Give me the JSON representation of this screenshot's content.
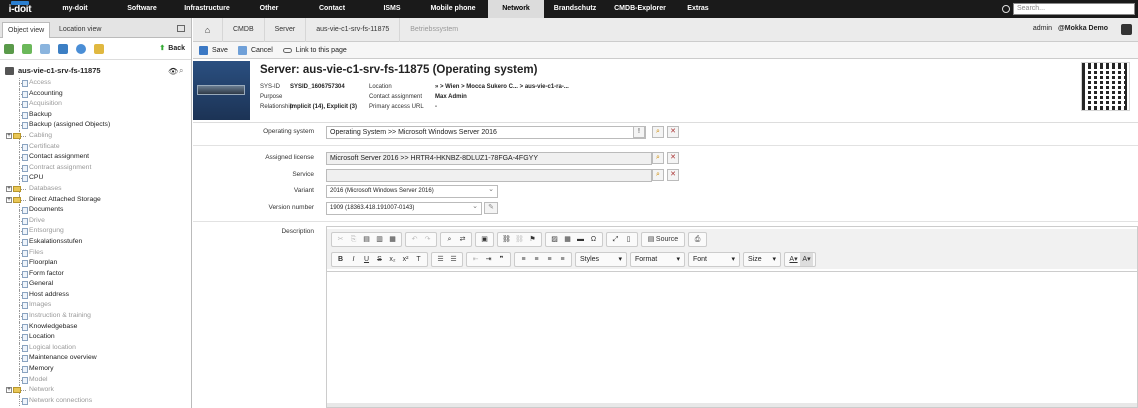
{
  "topbar": {
    "logo": "i-doit",
    "menu": [
      {
        "label": "my-doit",
        "active": false
      },
      {
        "label": "Software",
        "active": false
      },
      {
        "label": "Infrastructure",
        "active": false
      },
      {
        "label": "Other",
        "active": false
      },
      {
        "label": "Contact",
        "active": false
      },
      {
        "label": "ISMS",
        "active": false
      },
      {
        "label": "Mobile phone",
        "active": false
      },
      {
        "label": "Network",
        "active": true
      },
      {
        "label": "Brandschutz",
        "active": false
      },
      {
        "label": "CMDB-Explorer",
        "active": false
      },
      {
        "label": "Extras",
        "active": false
      }
    ],
    "search_placeholder": "Search..."
  },
  "left": {
    "tabs": [
      "Object view",
      "Location view"
    ],
    "back_label": "Back",
    "object_name": "aus-vie-c1-srv-fs-11875",
    "tree": [
      {
        "label": "Access",
        "grey": true,
        "folder": false
      },
      {
        "label": "Accounting",
        "grey": false,
        "folder": false
      },
      {
        "label": "Acquisition",
        "grey": true,
        "folder": false
      },
      {
        "label": "Backup",
        "grey": false,
        "folder": false
      },
      {
        "label": "Backup (assigned Objects)",
        "grey": false,
        "folder": false
      },
      {
        "label": "Cabling",
        "grey": true,
        "folder": true
      },
      {
        "label": "Certificate",
        "grey": true,
        "folder": false
      },
      {
        "label": "Contact assignment",
        "grey": false,
        "folder": false
      },
      {
        "label": "Contract assignment",
        "grey": true,
        "folder": false
      },
      {
        "label": "CPU",
        "grey": false,
        "folder": false
      },
      {
        "label": "Databases",
        "grey": true,
        "folder": true
      },
      {
        "label": "Direct Attached Storage",
        "grey": false,
        "folder": true
      },
      {
        "label": "Documents",
        "grey": false,
        "folder": false
      },
      {
        "label": "Drive",
        "grey": true,
        "folder": false
      },
      {
        "label": "Entsorgung",
        "grey": true,
        "folder": false
      },
      {
        "label": "Eskalationsstufen",
        "grey": false,
        "folder": false
      },
      {
        "label": "Files",
        "grey": true,
        "folder": false
      },
      {
        "label": "Floorplan",
        "grey": false,
        "folder": false
      },
      {
        "label": "Form factor",
        "grey": false,
        "folder": false
      },
      {
        "label": "General",
        "grey": false,
        "folder": false
      },
      {
        "label": "Host address",
        "grey": false,
        "folder": false
      },
      {
        "label": "Images",
        "grey": true,
        "folder": false
      },
      {
        "label": "Instruction & training",
        "grey": true,
        "folder": false
      },
      {
        "label": "Knowledgebase",
        "grey": false,
        "folder": false
      },
      {
        "label": "Location",
        "grey": false,
        "folder": false
      },
      {
        "label": "Logical location",
        "grey": true,
        "folder": false
      },
      {
        "label": "Maintenance overview",
        "grey": false,
        "folder": false
      },
      {
        "label": "Memory",
        "grey": false,
        "folder": false
      },
      {
        "label": "Model",
        "grey": true,
        "folder": false
      },
      {
        "label": "Network",
        "grey": true,
        "folder": true
      },
      {
        "label": "Network connections",
        "grey": true,
        "folder": false
      }
    ]
  },
  "breadcrumb": [
    "CMDB",
    "Server",
    "aus-vie-c1-srv-fs-11875",
    "Betriebssystem"
  ],
  "user": {
    "name": "admin",
    "tenant": "@Mokka Demo"
  },
  "actions": {
    "save": "Save",
    "cancel": "Cancel",
    "link": "Link to this page"
  },
  "header": {
    "title": "Server: aus-vie-c1-srv-fs-11875 (Operating system)",
    "sysid_key": "SYS-ID",
    "sysid_val": "SYSID_1606757304",
    "purpose_key": "Purpose",
    "purpose_val": "",
    "relationship_key": "Relationship",
    "relationship_val": "Implicit (14), Explicit (3)",
    "location_key": "Location",
    "location_val": "» > Wien > Mocca Sukero C... > aus-vie-c1-ra-...",
    "contact_key": "Contact assignment",
    "contact_val": "Max Admin",
    "url_key": "Primary access URL",
    "url_val": "-"
  },
  "form": {
    "os_label": "Operating system",
    "os_value": "Operating System >> Microsoft Windows Server 2016",
    "license_label": "Assigned license",
    "license_value": "Microsoft Server 2016 >> HRTR4-HKNBZ-8DLUZ1-78FGA-4FGYY",
    "service_label": "Service",
    "service_value": "",
    "variant_label": "Variant",
    "variant_value": "2016 (Microsoft Windows Server 2016)",
    "version_label": "Version number",
    "version_value": "1909 (18363.418.191007-0143)",
    "description_label": "Description"
  },
  "editor": {
    "source_label": "Source",
    "styles": "Styles",
    "format": "Format",
    "font": "Font",
    "size": "Size"
  }
}
